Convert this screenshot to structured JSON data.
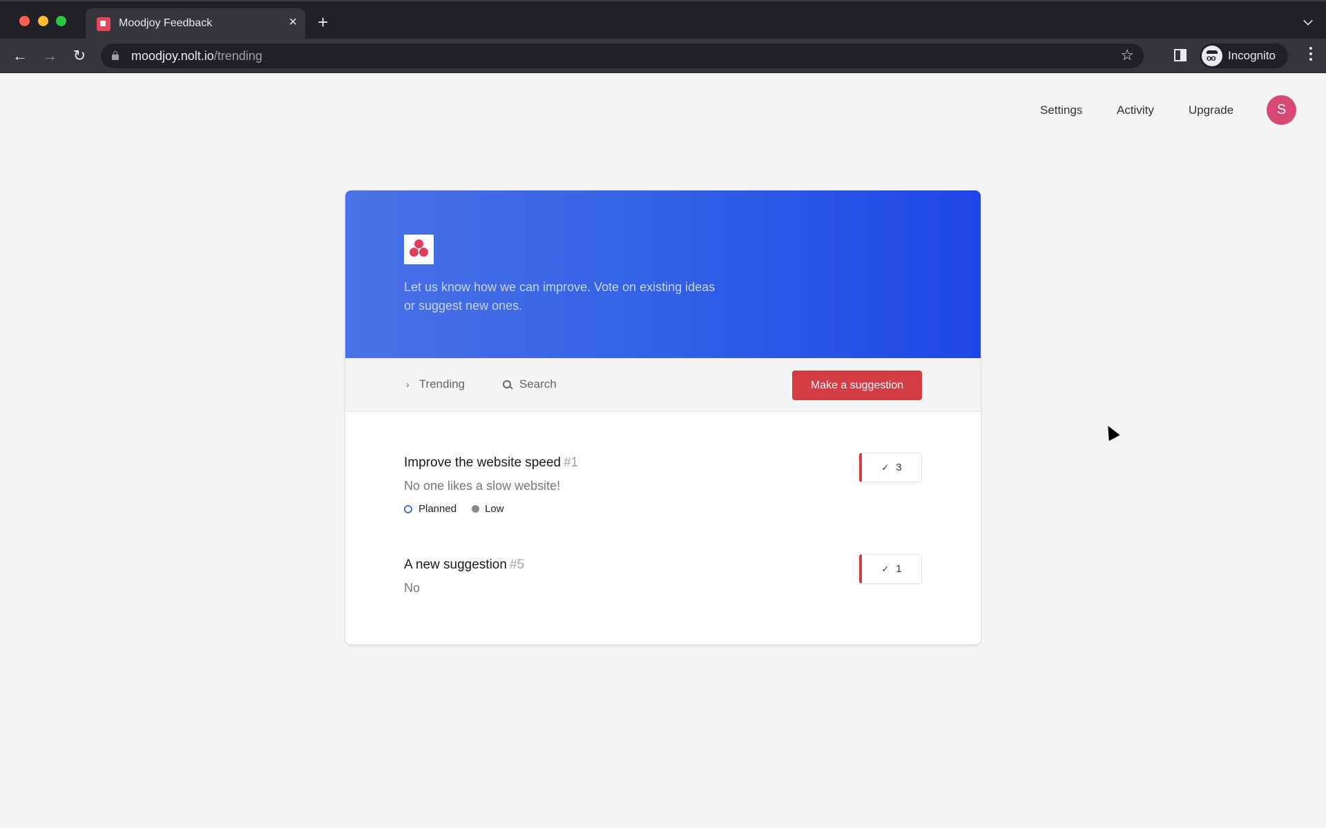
{
  "browser": {
    "tab_title": "Moodjoy Feedback",
    "url_host": "moodjoy.nolt.io",
    "url_path": "/trending",
    "profile_label": "Incognito"
  },
  "topnav": {
    "settings": "Settings",
    "activity": "Activity",
    "upgrade": "Upgrade",
    "avatar_initial": "S"
  },
  "hero": {
    "description": "Let us know how we can improve. Vote on existing ideas or suggest new ones."
  },
  "filterbar": {
    "trending_label": "Trending",
    "search_label": "Search",
    "suggest_button": "Make a suggestion"
  },
  "posts": [
    {
      "title": "Improve the website speed",
      "number": "#1",
      "description": "No one likes a slow website!",
      "status": "Planned",
      "priority": "Low",
      "votes": "3"
    },
    {
      "title": "A new suggestion",
      "number": "#5",
      "description": "No",
      "votes": "1"
    }
  ],
  "colors": {
    "brand_red": "#d63c44",
    "hero_blue": "#1e47e6",
    "avatar": "#d64a72",
    "planned": "#4a6fd6"
  }
}
